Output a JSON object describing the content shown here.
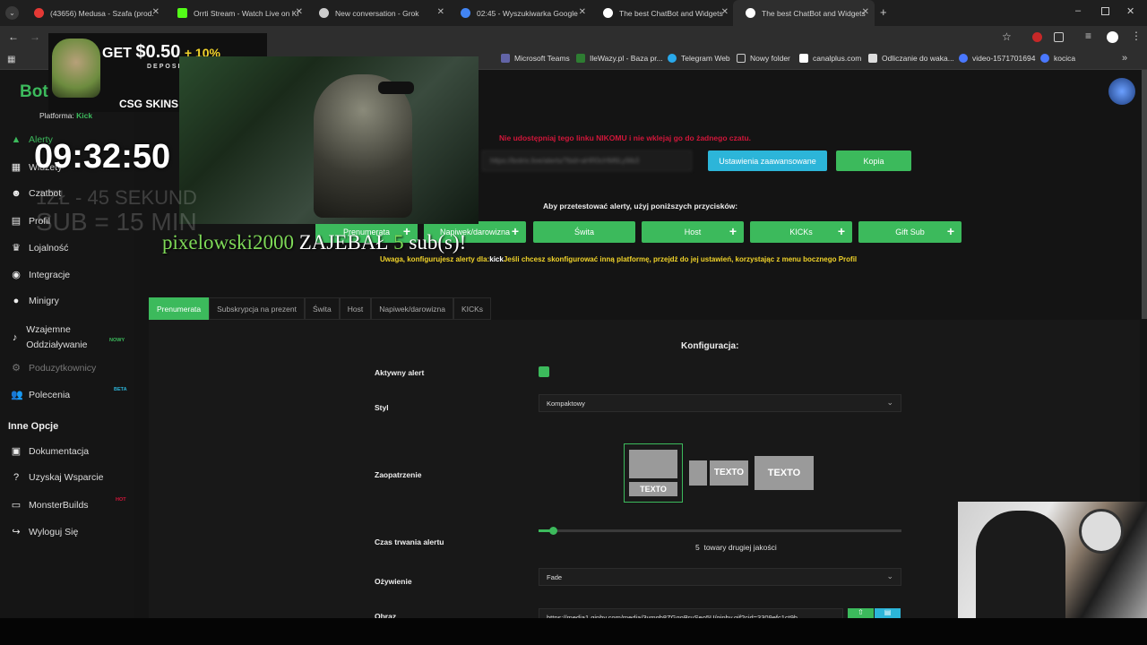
{
  "browser": {
    "tabs": [
      {
        "title": "(43656) Medusa - Szafa (prod.",
        "color": "#e53935"
      },
      {
        "title": "Orrti Stream - Watch Live on Ki",
        "color": "#53fc18"
      },
      {
        "title": "New conversation - Grok",
        "color": "#cccccc"
      },
      {
        "title": "02:45 - Wyszukiwarka Google",
        "color": "#4285f4"
      },
      {
        "title": "The best ChatBot and Widgets",
        "color": "#ffffff"
      },
      {
        "title": "The best ChatBot and Widgets",
        "color": "#ffffff"
      }
    ],
    "bookmarks": [
      "Microsoft Teams",
      "IleWazy.pl - Baza pr...",
      "Telegram Web",
      "Nowy folder",
      "canalplus.com",
      "Odliczanie do waka...",
      "video-1571701694",
      "kocica"
    ]
  },
  "sidebar": {
    "logo": "Bot",
    "platform_label": "Platforma:",
    "platform_value": "Kick",
    "items": [
      "Alerty",
      "Widżety",
      "Czatbot",
      "Profil",
      "Lojalność",
      "Integracje",
      "Minigry",
      "Wzajemne Oddziaływanie",
      "Poduzytkownicy",
      "Polecenia"
    ],
    "badge_new": "NOWY",
    "badge_beta": "BETA",
    "section2": "Inne Opcje",
    "items2": [
      "Dokumentacja",
      "Uzyskaj Wsparcie",
      "MonsterBuilds",
      "Wyloguj Się"
    ],
    "badge_hot": "HOT"
  },
  "main": {
    "warning": "Nie udostępniaj tego linku NIKOMU i nie wklejaj go do żadnego czatu.",
    "url": "https://botrix.live/alerts/?bid=aHR0cHM6Ly9ib3",
    "btn_advanced": "Ustawienia zaawansowane",
    "btn_copy": "Kopia",
    "test_text": "Aby przetestować alerty, użyj poniższych przycisków:",
    "test_buttons": [
      "Prenumerata",
      "Napiwek/darowizna",
      "Świta",
      "Host",
      "KICKs",
      "Gift Sub"
    ],
    "notice_a": "Uwaga, konfigurujesz alerty dla:",
    "notice_b": "kick",
    "notice_c": "Jeśli chcesz skonfigurować inną platformę, przejdź do jej ustawień, korzystając z menu bocznego Profil",
    "tabs": [
      "Prenumerata",
      "Subskrypcja na prezent",
      "Świta",
      "Host",
      "Napiwek/darowizna",
      "KICKs"
    ],
    "config_title": "Konfiguracja:",
    "active_label": "Aktywny alert",
    "style_label": "Styl",
    "style_value": "Kompaktowy",
    "layout_label": "Zaopatrzenie",
    "layout_text": "TEXTO",
    "duration_label": "Czas trwania alertu",
    "duration_value": "5",
    "duration_unit": "towary drugiej jakości",
    "anim_label": "Ożywienie",
    "anim_value": "Fade",
    "image_label": "Obraz",
    "image_url": "https://media1.giphy.com/media/3vmgb8ZGgoBruSeo5U/giphy.gif?cid=3309efc1ct9h"
  },
  "overlay": {
    "ad_get": "GET",
    "ad_amount": "$0.50",
    "ad_plus": "+ 10%",
    "ad_deposit": "DEPOSIT",
    "ad_brand": "CSG SKINS",
    "clock": "09:32:50",
    "sub_rule_1": "1ZŁ - 45 SEKUND",
    "sub_rule_2": "SUB = 15 MIN",
    "alert_user": "pixelowski2000",
    "alert_verb": "ZAJEBAŁ",
    "alert_count": "5",
    "alert_suffix": "sub(s)!"
  },
  "colors": {
    "accent": "#3cba5c",
    "accent_blue": "#2cb5d9",
    "warning": "#d1163a",
    "notice": "#f1d32a"
  }
}
